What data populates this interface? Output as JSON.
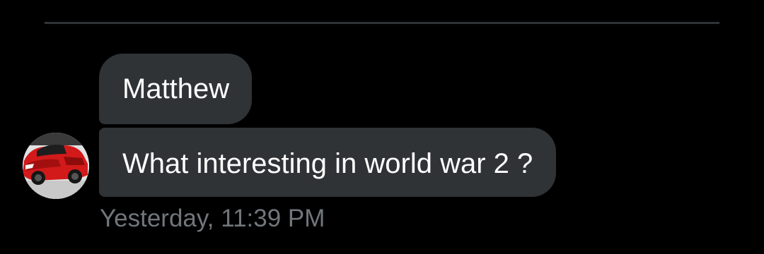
{
  "conversation": {
    "messages": [
      {
        "text": "Matthew"
      },
      {
        "text": "What interesting in world war 2 ?"
      }
    ],
    "timestamp": "Yesterday, 11:39 PM",
    "sender_avatar": {
      "icon": "red-sports-car-photo"
    }
  },
  "colors": {
    "background": "#000000",
    "bubble": "#2f3336",
    "text": "#ffffff",
    "timestamp": "#71767b",
    "divider": "#2f3336"
  }
}
